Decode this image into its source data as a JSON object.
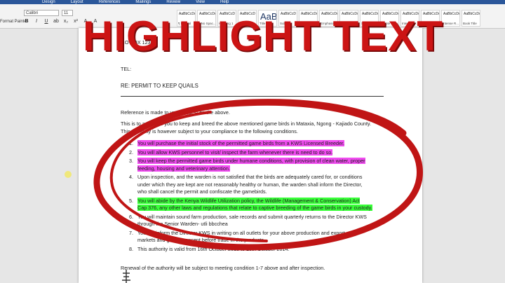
{
  "app": {
    "menu": [
      "Design",
      "Layout",
      "References",
      "Mailings",
      "Review",
      "View",
      "Help"
    ],
    "font_name": "Calibri",
    "font_size": "11",
    "format_buttons": [
      "B",
      "I",
      "U",
      "ab",
      "x₂",
      "x²",
      "A",
      "A"
    ],
    "side_label": "Format Painter",
    "styles": [
      {
        "sample": "AaBbCcDc",
        "name": "¶ Normal"
      },
      {
        "sample": "AaBbCcDc",
        "name": "¶ No Spac..."
      },
      {
        "sample": "AaBbCcD",
        "name": "Heading 1"
      },
      {
        "sample": "AaBbCcD",
        "name": "Heading 2"
      },
      {
        "sample": "AaB",
        "name": "Title"
      },
      {
        "sample": "AaBbCcD",
        "name": "Subtitle"
      },
      {
        "sample": "AaBbCcDc",
        "name": "Subtle Em..."
      },
      {
        "sample": "AaBbCcDc",
        "name": "Emphasis"
      },
      {
        "sample": "AaBbCcDc",
        "name": "Intense E..."
      },
      {
        "sample": "AaBbCcDc",
        "name": "Strong"
      },
      {
        "sample": "AaBbCcDc",
        "name": "Quote"
      },
      {
        "sample": "AaBbCcDc",
        "name": "Intense Q..."
      },
      {
        "sample": "AaBbCcDc",
        "name": "Subtle Ref..."
      },
      {
        "sample": "AaBbCcDc",
        "name": "Intense R..."
      },
      {
        "sample": "AaBbCcDc",
        "name": "Book Title"
      }
    ]
  },
  "overlay": {
    "headline": "HIGHLIGHT TEXT",
    "circle_color": "#c01515"
  },
  "document": {
    "address_line": "P.O BOX 1234",
    "tel": "TEL:",
    "subject": "RE: PERMIT TO KEEP QUAILS",
    "para_ref": "Reference is made to your request on the above.",
    "para_auth1": "This is to authorize you to keep and breed the above mentioned game birds in Mataxia, Ngong - Kajiado County.",
    "para_auth2": "This authority is however subject to your compliance to the following conditions.",
    "conditions": [
      {
        "num": "1.",
        "lines": [
          "You will purchase the initial stock of the permitted game birds from a KWS Licensed Breeder."
        ],
        "highlight": "pink"
      },
      {
        "num": "2.",
        "lines": [
          "You will allow KWS personnel to visit/ inspect the farm whenever there is need to do so."
        ],
        "highlight": "pink"
      },
      {
        "num": "3.",
        "lines": [
          "You will keep the permitted game birds under humane conditions, with provision of clean water, proper",
          "feeding, housing and veterinary attention."
        ],
        "highlight": "pink"
      },
      {
        "num": "4.",
        "lines": [
          "Upon inspection, and the warden is not satisfied that the birds are adequately cared for, or conditions",
          "under which they are kept are not reasonably healthy or human, the warden shall inform the Director,",
          "who shall cancel the permit and confiscate the gamebirds."
        ],
        "highlight": "none"
      },
      {
        "num": "5.",
        "lines": [
          "You will abide by the Kenya Wildlife Utilization policy, the Wildlife (Management & Conservation) Act",
          "Cap 376, any other laws and regulations that relate to captive breeding of the game birds in your custody."
        ],
        "highlight": "green"
      },
      {
        "num": "6.",
        "lines": [
          "You will maintain sound farm production, sale records and submit quarterly returns to the Director KWS",
          "through the Senior Warden- utli bbcchea"
        ],
        "highlight": "none"
      },
      {
        "num": "7.",
        "lines": [
          "You will inform the Director KWS in writing on all outlets for your above production and export",
          "markets and get his consent before trade in the products."
        ],
        "highlight": "none"
      },
      {
        "num": "8.",
        "lines": [
          "This authority is valid from 16th October 2013 to 15th October 2014."
        ],
        "highlight": "none"
      }
    ],
    "renewal": "Renewal of the authority will be subject to meeting condition 1-7 above and after inspection."
  }
}
